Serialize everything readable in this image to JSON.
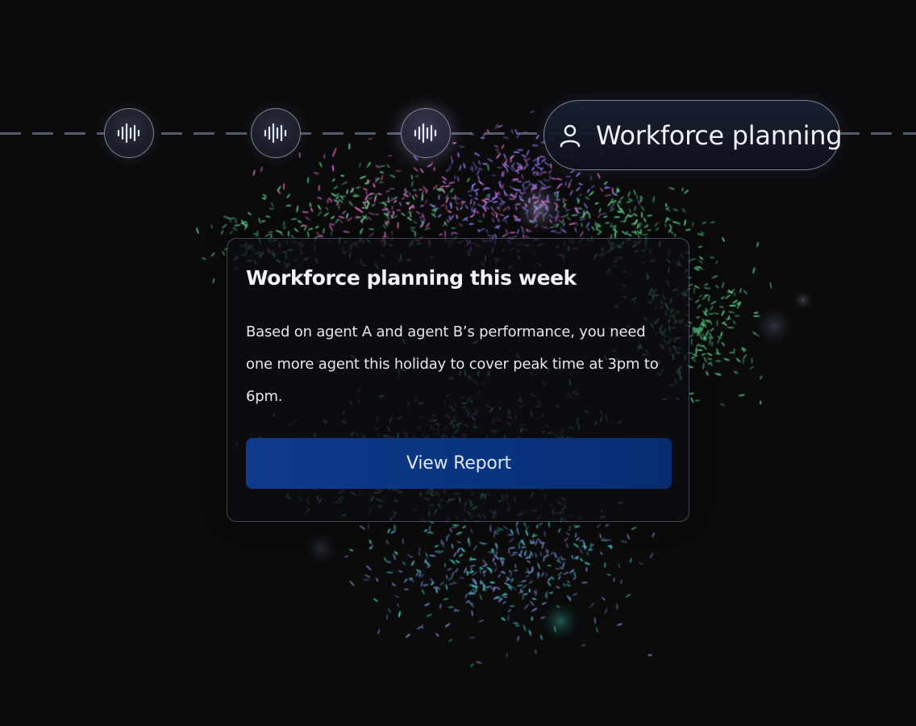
{
  "timeline": {
    "nodes": [
      {
        "icon": "audio-waveform-icon",
        "state": "default"
      },
      {
        "icon": "audio-waveform-icon",
        "state": "default"
      },
      {
        "icon": "audio-waveform-icon",
        "state": "active"
      }
    ],
    "active_pill": {
      "icon": "user-icon",
      "label": "Workforce planning"
    }
  },
  "card": {
    "title": "Workforce planning this week",
    "body": "Based on agent A and agent B’s performance, you need one more agent this holiday to cover peak time at 3pm to 6pm.",
    "button_label": "View Report"
  },
  "colors": {
    "background": "#0b0b0c",
    "button": "#0a3685",
    "particle_green": "#5fd08a",
    "particle_purple": "#8a78f0",
    "particle_pink": "#e070c8",
    "particle_teal": "#3fd6c8",
    "particle_blue": "#6f86c6"
  }
}
